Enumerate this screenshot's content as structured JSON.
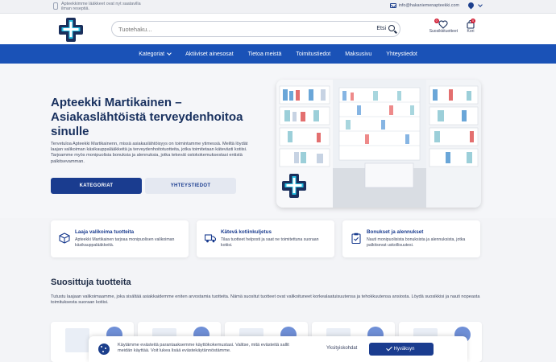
{
  "topbar": {
    "info_text": "Apteekkimme lääkkeet ovat nyt saatavilla ilman reseptiä.",
    "email": "info@hakaniemenapteekki.com"
  },
  "header": {
    "search_placeholder": "Tuotehaku...",
    "search_button": "Etsi",
    "favorites_label": "Suosikkituotteet",
    "favorites_count": "0",
    "cart_label": "Kori",
    "cart_count": "0"
  },
  "nav": {
    "items": [
      {
        "label": "Kategoriat"
      },
      {
        "label": "Aktiiviset ainesosat"
      },
      {
        "label": "Tietoa meistä"
      },
      {
        "label": "Toimitustiedot"
      },
      {
        "label": "Maksusivu"
      },
      {
        "label": "Yhteystiedot"
      }
    ]
  },
  "hero": {
    "title": "Apteekki Martikainen – Asiakaslähtöistä terveydenhoitoa sinulle",
    "description": "Tervetuloa Apteekki Martikainenn, missä asiakaslähtöisyys on toimintamme ytimessä. Meiltä löydät laajan valikoiman käsikauppalääkkeitä ja terveydenhoitotuotteita, jotka toimitetaan kätevästi kotiisi. Tarjoamme myös monipuolisia bonuksia ja alennuksia, jotka tekevät ostokokemuksestasi entistä palkitsevamman.",
    "primary_button": "KATEGORIAT",
    "secondary_button": "YHTEYSTIEDOT"
  },
  "features": [
    {
      "title": "Laaja valikoima tuotteita",
      "text": "Apteekki Martikainen tarjoaa monipuolisen valikoiman käsikauppalääkkeitä.",
      "icon": "box-icon"
    },
    {
      "title": "Kätevä kotiinkuljetus",
      "text": "Tilaa tuotteet helposti ja saat ne toimitettuna suoraan kotiisi.",
      "icon": "truck-icon"
    },
    {
      "title": "Bonukset ja alennukset",
      "text": "Nauti monipuolisista bonuksista ja alennuksista, jotka palkitsevat uskollisuutesi.",
      "icon": "clipboard-icon"
    }
  ],
  "popular": {
    "title": "Suosittuja tuotteita",
    "description": "Tutustu laajaan valikoimaamme, joka sisältää asiakkaidemme eniten arvostamia tuotteita. Nämä suositut tuotteet ovat valikoituneet korkealaatuisuutensa ja tehokkuutensa ansiosta. Löydä suosikkisi ja nauti nopeasta toimituksesta suoraan kotiisi."
  },
  "cookie": {
    "text": "Käytämme evästeitä parantaaksemme käyttökokemustasi. Valitse, mitä evästeitä sallit meidän käyttää. Voit lukea lisää evästekäytännöstämme.",
    "details_button": "Yksityiskohdat",
    "accept_button": "Hyväksyn"
  },
  "colors": {
    "brand_blue": "#1a52b7",
    "dark_blue": "#1a3c8f",
    "accent_cyan": "#27c3e6"
  }
}
